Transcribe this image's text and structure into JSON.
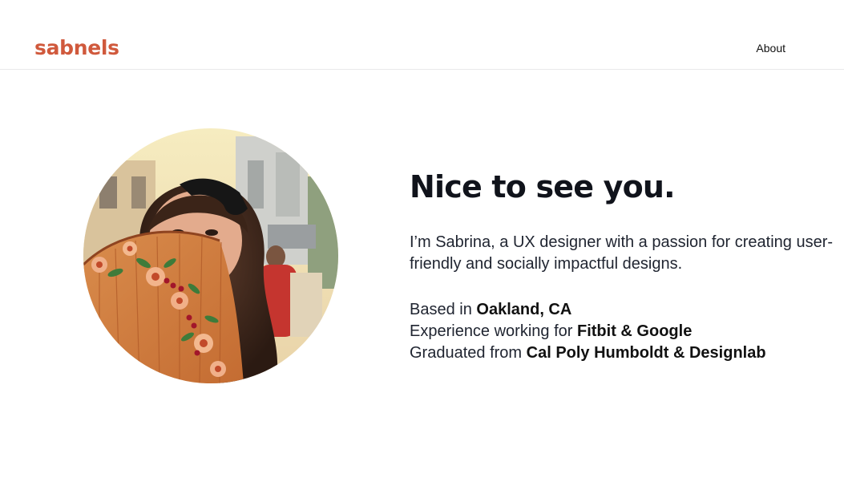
{
  "header": {
    "logo_text": "sabnels",
    "nav": {
      "about_label": "About"
    },
    "brand_color": "#d0593c"
  },
  "hero": {
    "headline": "Nice to see you.",
    "intro": "I’m Sabrina, a UX designer with a passion for creating user-friendly and socially impactful designs.",
    "facts": [
      {
        "prefix": "Based in",
        "highlight": "Oakland, CA"
      },
      {
        "prefix": "Experience working for",
        "highlight": "Fitbit & Google"
      },
      {
        "prefix": "Graduated from",
        "highlight": "Cal Poly Humboldt & Designlab"
      }
    ]
  },
  "portrait": {
    "icon": "profile-photo"
  }
}
